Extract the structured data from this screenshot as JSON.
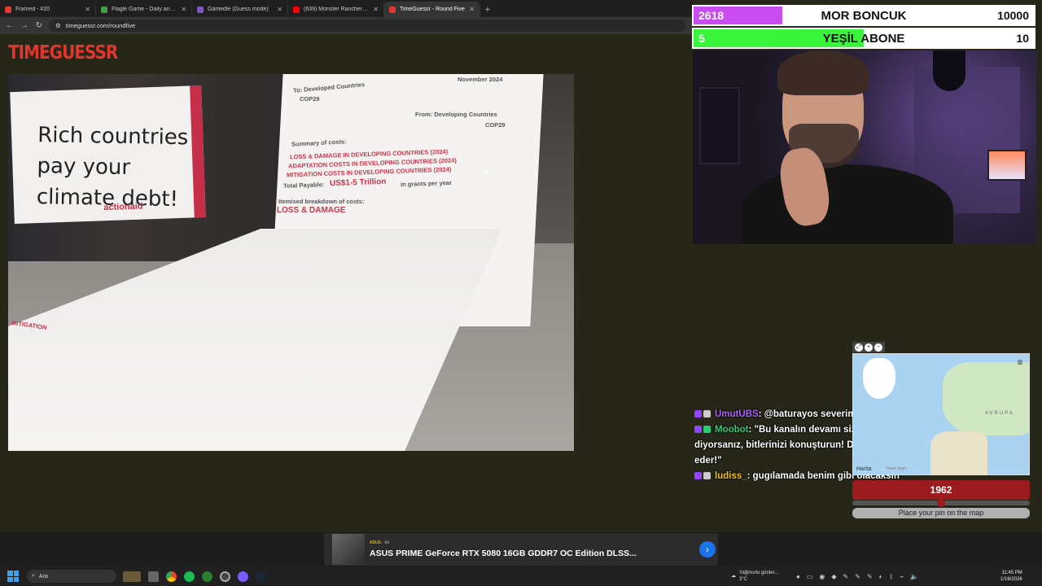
{
  "browser": {
    "tabs": [
      {
        "title": "Framed - #20",
        "color": "#e53935",
        "active": false
      },
      {
        "title": "Flagle Game - Daily and Unlimited",
        "color": "#43a047",
        "active": false
      },
      {
        "title": "Gamedle (Guess mode)",
        "color": "#7e57c2",
        "active": false
      },
      {
        "title": "(639) Monster Rancher | Short",
        "color": "#ff0000",
        "active": false
      },
      {
        "title": "TimeGuessr - Round Five",
        "color": "#e0362c",
        "active": true
      }
    ],
    "url": "timeguessr.com/roundfive"
  },
  "site": {
    "logo": "TIMEGUESSR"
  },
  "photo": {
    "banner_text": "Rich countries pay your climate debt!",
    "banner_brand": "actionaid",
    "doc_date": "November 2024",
    "doc_to": "To: Developed Countries",
    "doc_to2": "COP29",
    "doc_from": "From: Developing Countries",
    "doc_from2": "COP29",
    "doc_summary": "Summary of costs:",
    "doc_line1": "LOSS & DAMAGE IN DEVELOPING COUNTRIES (2024)",
    "doc_line2": "ADAPTATION COSTS IN DEVELOPING COUNTRIES (2024)",
    "doc_line3": "MITIGATION COSTS IN DEVELOPING COUNTRIES (2024)",
    "doc_total_label": "Total Payable:",
    "doc_total_value": "US$1-5 Trillion",
    "doc_total_suffix": "in grants per year",
    "doc_itemised": "Itemised breakdown of costs:",
    "doc_loss": "LOSS & DAMAGE",
    "doc_mitigation": "MITIGATION"
  },
  "goals": [
    {
      "left": "2618",
      "label": "MOR BONCUK",
      "right": "10000",
      "fill": 0.2618,
      "color": "#c84cf0"
    },
    {
      "left": "5",
      "label": "YEŞİL ABONE",
      "right": "10",
      "fill": 0.5,
      "color": "#39f53c"
    }
  ],
  "chat": [
    {
      "user": "UmutUBS",
      "user_color": "#b05cff",
      "message": ": @baturayos severim"
    },
    {
      "user": "Moobot",
      "user_color": "#2ecc71",
      "message": ": \"Bu kanalın devamı size bağlı! 'Labi yayın açsın!' diyorsanız, bitlerinizi konuşturun! Destek oldukça yayınlar da devam eder!\""
    },
    {
      "user": "ludiss_",
      "user_color": "#f1c40f",
      "message": ": gugılamada benim gibi olacaksın"
    }
  ],
  "map": {
    "region_label": "AVRUPA",
    "brand": "Harita",
    "legal": "Yasal Uyarı"
  },
  "year": {
    "value": "1962",
    "slider_fraction": 0.5
  },
  "pin_button": "Place your pin on the map",
  "ad": {
    "brand": "ASUS",
    "tag": "Ad",
    "title": "ASUS PRIME GeForce RTX 5080 16GB GDDR7 OC Edition DLSS..."
  },
  "taskbar": {
    "search": "Ara",
    "weather_line1": "Yağmurlu günler...",
    "weather_line2": "3°C",
    "time": "11:45 PM",
    "date": "1/16/2026"
  }
}
